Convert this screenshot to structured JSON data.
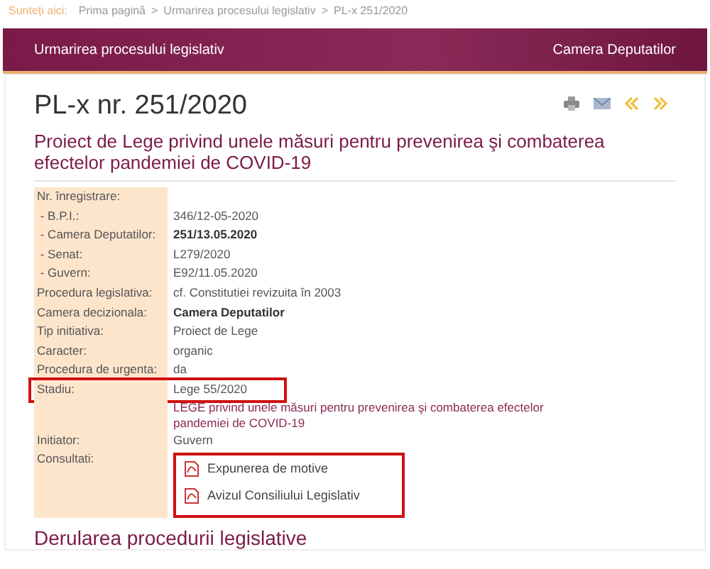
{
  "breadcrumb": {
    "label": "Sunteți aici:",
    "items": [
      "Prima pagină",
      ">",
      "Urmarirea procesului legislativ",
      ">",
      "PL-x 251/2020"
    ]
  },
  "header": {
    "left": "Urmarirea procesului legislativ",
    "right": "Camera Deputatilor"
  },
  "title": "PL-x nr. 251/2020",
  "subtitle": "Proiect de Lege privind unele măsuri pentru prevenirea şi combaterea efectelor pandemiei de COVID-19",
  "rows": [
    {
      "kind": "text",
      "label": "Nr. înregistrare:",
      "highlighted": false
    },
    {
      "kind": "text",
      "label": " - B.P.I.:",
      "value": "346/12-05-2020",
      "bold": false,
      "highlighted": false
    },
    {
      "kind": "text",
      "label": " - Camera Deputatilor:",
      "value": "251/13.05.2020",
      "bold": true,
      "highlighted": false
    },
    {
      "kind": "text",
      "label": " - Senat:",
      "value": "L279/2020",
      "bold": false,
      "highlighted": false
    },
    {
      "kind": "text",
      "label": " - Guvern:",
      "value": "E92/11.05.2020",
      "bold": false,
      "highlighted": false
    },
    {
      "kind": "text",
      "label": "Procedura legislativa:",
      "value": "cf. Constitutiei revizuita în 2003",
      "bold": false,
      "highlighted": false
    },
    {
      "kind": "text",
      "label": "Camera decizionala:",
      "value": "Camera Deputatilor",
      "bold": true,
      "highlighted": false
    },
    {
      "kind": "text",
      "label": "Tip initiativa:",
      "value": "Proiect de Lege",
      "bold": false,
      "highlighted": false
    },
    {
      "kind": "text",
      "label": "Caracter:",
      "value": "organic",
      "bold": false,
      "highlighted": false
    },
    {
      "kind": "text",
      "label": "Procedura de urgenta:",
      "value": "da",
      "bold": false,
      "highlighted": false
    },
    {
      "kind": "text",
      "label": "Stadiu:",
      "value": "Lege 55/2020",
      "bold": false,
      "highlighted": true
    },
    {
      "kind": "link",
      "value": "LEGE privind unele măsuri pentru prevenirea şi combaterea efectelor pandemiei de COVID-19"
    },
    {
      "kind": "text",
      "label": "Initiator:",
      "value": "Guvern",
      "bold": false,
      "highlighted": false
    },
    {
      "kind": "documents",
      "label": "Consultati:",
      "documents": [
        "Expunerea de motive",
        "Avizul Consiliului Legislativ"
      ],
      "highlighted": true
    }
  ],
  "section_heading": "Derularea procedurii legislative"
}
